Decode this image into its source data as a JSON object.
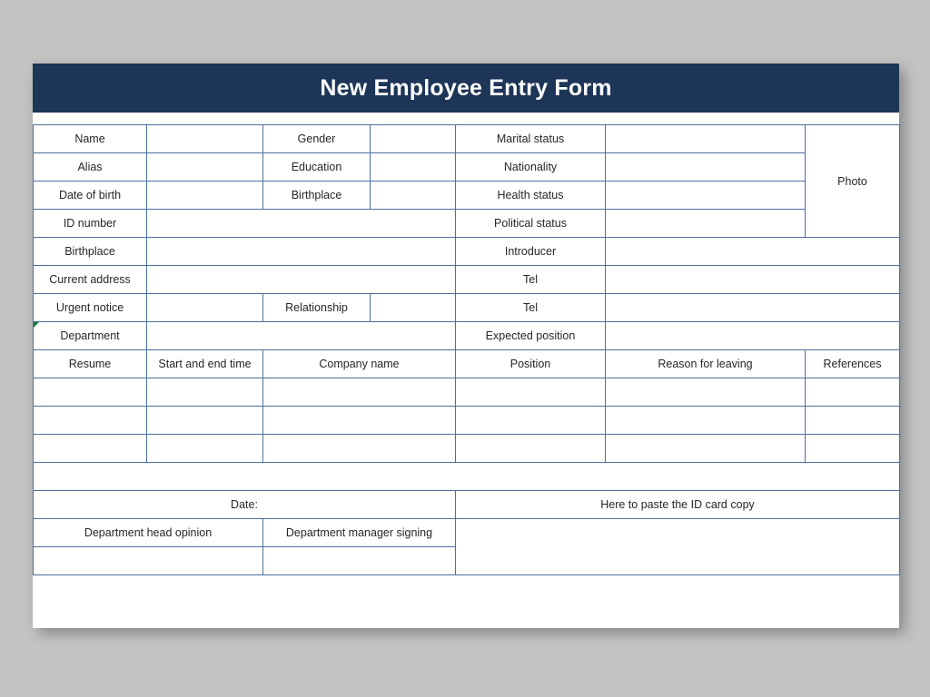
{
  "header": {
    "title": "New Employee Entry Form",
    "bar_color": "#1d3557",
    "text_color": "#ffffff"
  },
  "theme": {
    "background": "#c3c3c3",
    "page_background": "#ffffff",
    "grid_line": "#4b6f9c",
    "text": "#262626",
    "marker_green": "#1e7a34"
  },
  "personal_section": {
    "rows": [
      {
        "label_1": "Name",
        "label_2": "Gender",
        "label_3": "Marital status"
      },
      {
        "label_1": "Alias",
        "label_2": "Education",
        "label_3": "Nationality"
      },
      {
        "label_1": "Date of birth",
        "label_2": "Birthplace",
        "label_3": "Health status"
      },
      {
        "label_1": "ID number",
        "label_3": "Political status"
      },
      {
        "label_1": "Birthplace",
        "label_3": "Introducer"
      },
      {
        "label_1": "Current address",
        "label_3": "Tel"
      },
      {
        "label_1": "Urgent notice",
        "label_2": "Relationship",
        "label_3": "Tel"
      },
      {
        "label_1": "Department",
        "label_3": "Expected position"
      }
    ],
    "photo_label": "Photo"
  },
  "resume_section": {
    "headers": [
      "Resume",
      "Start and end time",
      "Company name",
      "Position",
      "Reason for leaving",
      "References"
    ],
    "empty_row_count": 3
  },
  "footer_section": {
    "date_label": "Date:",
    "id_card_label": "Here to paste the ID card copy",
    "head_opinion_label": "Department head opinion",
    "manager_signing_label": "Department manager signing"
  }
}
